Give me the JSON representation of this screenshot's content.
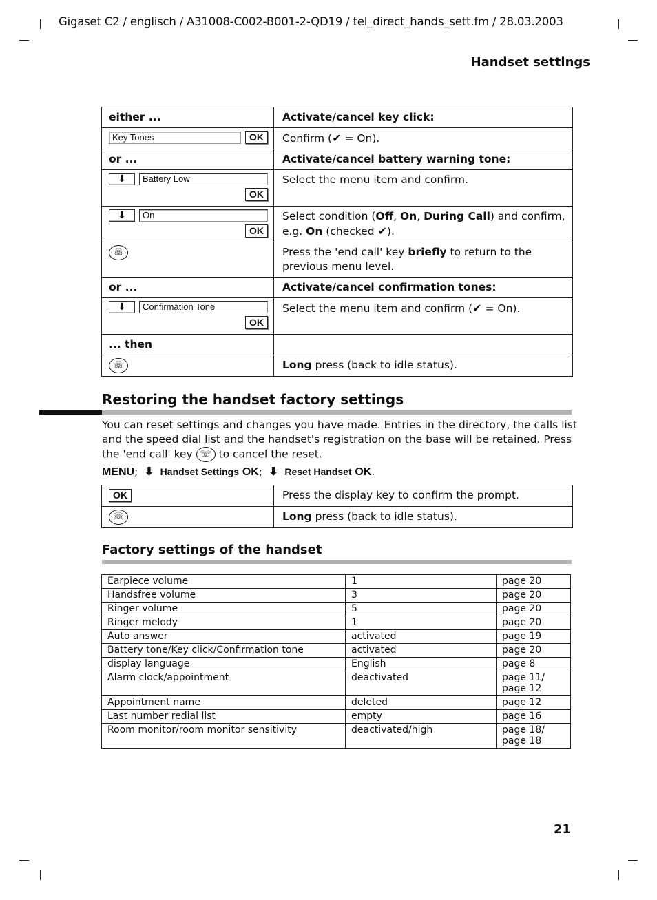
{
  "header": {
    "meta": "Gigaset C2 / englisch / A31008-C002-B001-2-QD19 / tel_direct_hands_sett.fm / 28.03.2003",
    "section": "Handset settings"
  },
  "icons": {
    "end_call": "☏",
    "down_arrow": "⬇",
    "check": "✔"
  },
  "steps_table": {
    "rows": [
      {
        "left": "either ...",
        "right": "Activate/cancel key click:"
      },
      {
        "display": "Key Tones",
        "ok": "OK",
        "right_pre": "Confirm (",
        "right_post": " = On)."
      },
      {
        "left": "or ...",
        "right": "Activate/cancel battery warning tone:"
      },
      {
        "display": "Battery Low",
        "ok": "OK",
        "right": "Select the menu item and confirm."
      },
      {
        "display": "On",
        "ok": "OK",
        "right_a": "Select condition (",
        "off": "Off",
        "sep1": ", ",
        "on": "On",
        "sep2": ", ",
        "during": "During Call",
        "right_b": ") and confirm, e.g. ",
        "eg_on": "On",
        "right_c": " (checked ",
        "right_d": ")."
      },
      {
        "right_a": "Press the 'end call' key ",
        "bold": "briefly",
        "right_b": " to return to the previous menu level."
      },
      {
        "left": "or ...",
        "right": "Activate/cancel confirmation tones:"
      },
      {
        "display": "Confirmation Tone",
        "ok": "OK",
        "right_pre": "Select the menu item and confirm (",
        "right_post": " = On)."
      },
      {
        "left": "... then",
        "right": ""
      },
      {
        "bold": "Long",
        "right": " press (back to idle status)."
      }
    ]
  },
  "restore": {
    "title": "Restoring the handset factory settings",
    "para_a": "You can reset settings and changes you have made. Entries in the directory, the calls list and the speed dial list and the handset's registration on the base will be retained. Press the 'end call' key ",
    "para_b": " to cancel the reset.",
    "menu": "MENU",
    "sep": ";",
    "item1": "Handset Settings",
    "ok1": "OK",
    "item2": "Reset Handset",
    "ok2": "OK",
    "end": ".",
    "table": [
      {
        "key": "OK",
        "right": "Press the display key to confirm the prompt."
      },
      {
        "bold": "Long",
        "right": " press (back to idle status)."
      }
    ]
  },
  "factory": {
    "title": "Factory settings of the handset",
    "rows": [
      {
        "setting": "Earpiece volume",
        "value": "1",
        "page": "page 20"
      },
      {
        "setting": "Handsfree volume",
        "value": "3",
        "page": "page 20"
      },
      {
        "setting": "Ringer volume",
        "value": "5",
        "page": "page 20"
      },
      {
        "setting": "Ringer melody",
        "value": "1",
        "page": "page 20"
      },
      {
        "setting": "Auto answer",
        "value": "activated",
        "page": "page 19"
      },
      {
        "setting": "Battery tone/Key click/Confirmation tone",
        "value": "activated",
        "page": "page 20"
      },
      {
        "setting": "display language",
        "value": "English",
        "page": "page 8"
      },
      {
        "setting": "Alarm clock/appointment",
        "value": "deactivated",
        "page": "page 11/",
        "page2": "page 12"
      },
      {
        "setting": "Appointment name",
        "value": "deleted",
        "page": "page 12"
      },
      {
        "setting": "Last number redial list",
        "value": "empty",
        "page": "page 16"
      },
      {
        "setting": "Room monitor/room monitor sensitivity",
        "value": "deactivated/high",
        "page": "page 18/",
        "page2": "page 18"
      }
    ]
  },
  "page_number": "21"
}
